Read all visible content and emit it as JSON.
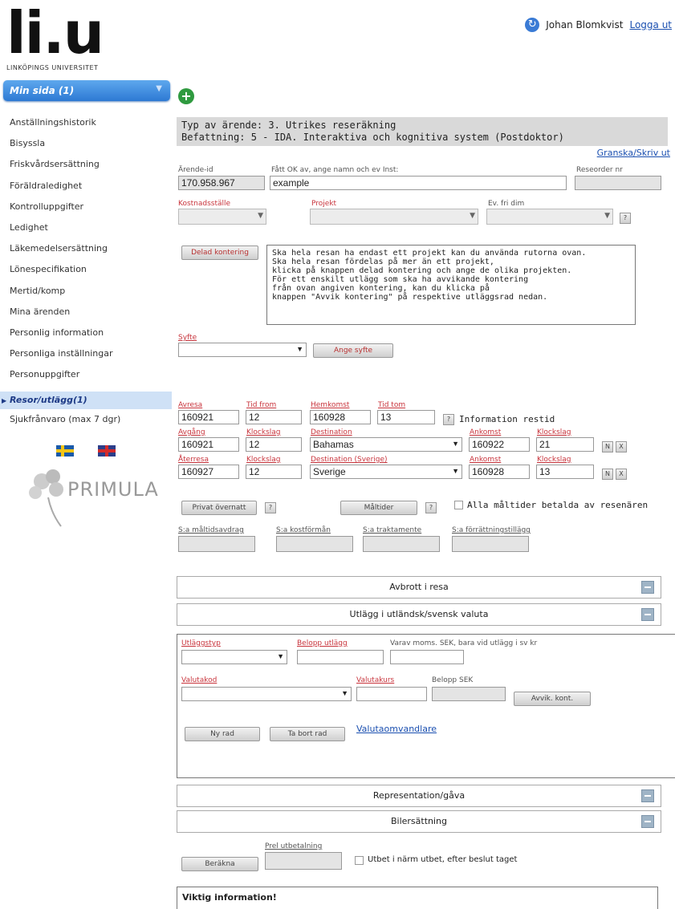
{
  "logo": {
    "mark": "li.u",
    "subtitle": "LINKÖPINGS UNIVERSITET"
  },
  "user": {
    "name": "Johan Blomkvist",
    "logout": "Logga ut"
  },
  "sidebar": {
    "minsida": "Min sida (1)",
    "items": [
      "Anställningshistorik",
      "Bisyssla",
      "Friskvårdsersättning",
      "Föräldraledighet",
      "Kontrolluppgifter",
      "Ledighet",
      "Läkemedelsersättning",
      "Lönespecifikation",
      "Mertid/komp",
      "Mina ärenden",
      "Personlig information",
      "Personliga inställningar",
      "Personuppgifter"
    ],
    "active": "Resor/utlägg(1)",
    "after": "Sjukfrånvaro (max 7 dgr)",
    "primula": "PRIMULA"
  },
  "header": {
    "typ": "Typ av ärende: 3. Utrikes reseräkning",
    "befattning": "Befattning: 5 - IDA. Interaktiva och kognitiva system (Postdoktor)",
    "granska": "Granska/Skriv ut"
  },
  "form": {
    "arende_label": "Ärende-id",
    "arende_value": "170.958.967",
    "ok_label": "Fått OK av, ange namn och ev Inst:",
    "ok_value": "example",
    "reseorder_label": "Reseorder nr",
    "kostnadsstalle": "Kostnadsställe",
    "projekt": "Projekt",
    "frid": "Ev. fri dim",
    "delad": "Delad kontering",
    "info_text": "Ska hela resan ha endast ett projekt kan du använda rutorna ovan.\nSka hela resan fördelas på mer än ett projekt,\nklicka på knappen delad kontering och ange de olika projekten.\nFör ett enskilt utlägg som ska ha avvikande kontering\nfrån ovan angiven kontering, kan du klicka på\nknappen \"Avvik kontering\" på respektive utläggsrad nedan.",
    "syfte": "Syfte",
    "ange_syfte": "Ange syfte",
    "avresa": "Avresa",
    "tid_from": "Tid from",
    "hemkomst": "Hemkomst",
    "tid_tom": "Tid tom",
    "avresa_v": "160921",
    "tid_from_v": "12",
    "hemkomst_v": "160928",
    "tid_tom_v": "13",
    "info_restid": "Information restid",
    "avgang": "Avgång",
    "klockslag": "Klockslag",
    "destination": "Destination",
    "ankomst": "Ankomst",
    "avgang_v": "160921",
    "avgang_k": "12",
    "dest1": "Bahamas",
    "ank1": "160922",
    "ank1_k": "21",
    "aterresa": "Återresa",
    "dest_sv": "Destination (Sverige)",
    "ater_v": "160927",
    "ater_k": "12",
    "dest2": "Sverige",
    "ank2": "160928",
    "ank2_k": "13",
    "privat": "Privat övernatt",
    "maltider": "Måltider",
    "alla_maltider": "Alla måltider betalda av resenären",
    "sa_maltid": "S:a måltidsavdrag",
    "sa_kost": "S:a kostförmån",
    "sa_trakt": "S:a traktamente",
    "sa_forr": "S:a förrättningstillägg",
    "avbrott": "Avbrott i resa",
    "utlagg": "Utlägg i utländsk/svensk valuta",
    "utlaggstyp": "Utläggstyp",
    "belopp": "Belopp utlägg",
    "varav": "Varav moms. SEK, bara vid utlägg i sv kr",
    "valutakod": "Valutakod",
    "valutakurs": "Valutakurs",
    "belopp_sek": "Belopp SEK",
    "avvik": "Avvik. kont.",
    "ny_rad": "Ny rad",
    "ta_bort": "Ta bort rad",
    "valutaomv": "Valutaomvandlare",
    "representation": "Representation/gåva",
    "bilersattning": "Bilersättning",
    "prel": "Prel utbetalning",
    "berakna": "Beräkna",
    "utbet": "Utbet i närm utbet, efter beslut taget",
    "viktig": "Viktig information!"
  }
}
